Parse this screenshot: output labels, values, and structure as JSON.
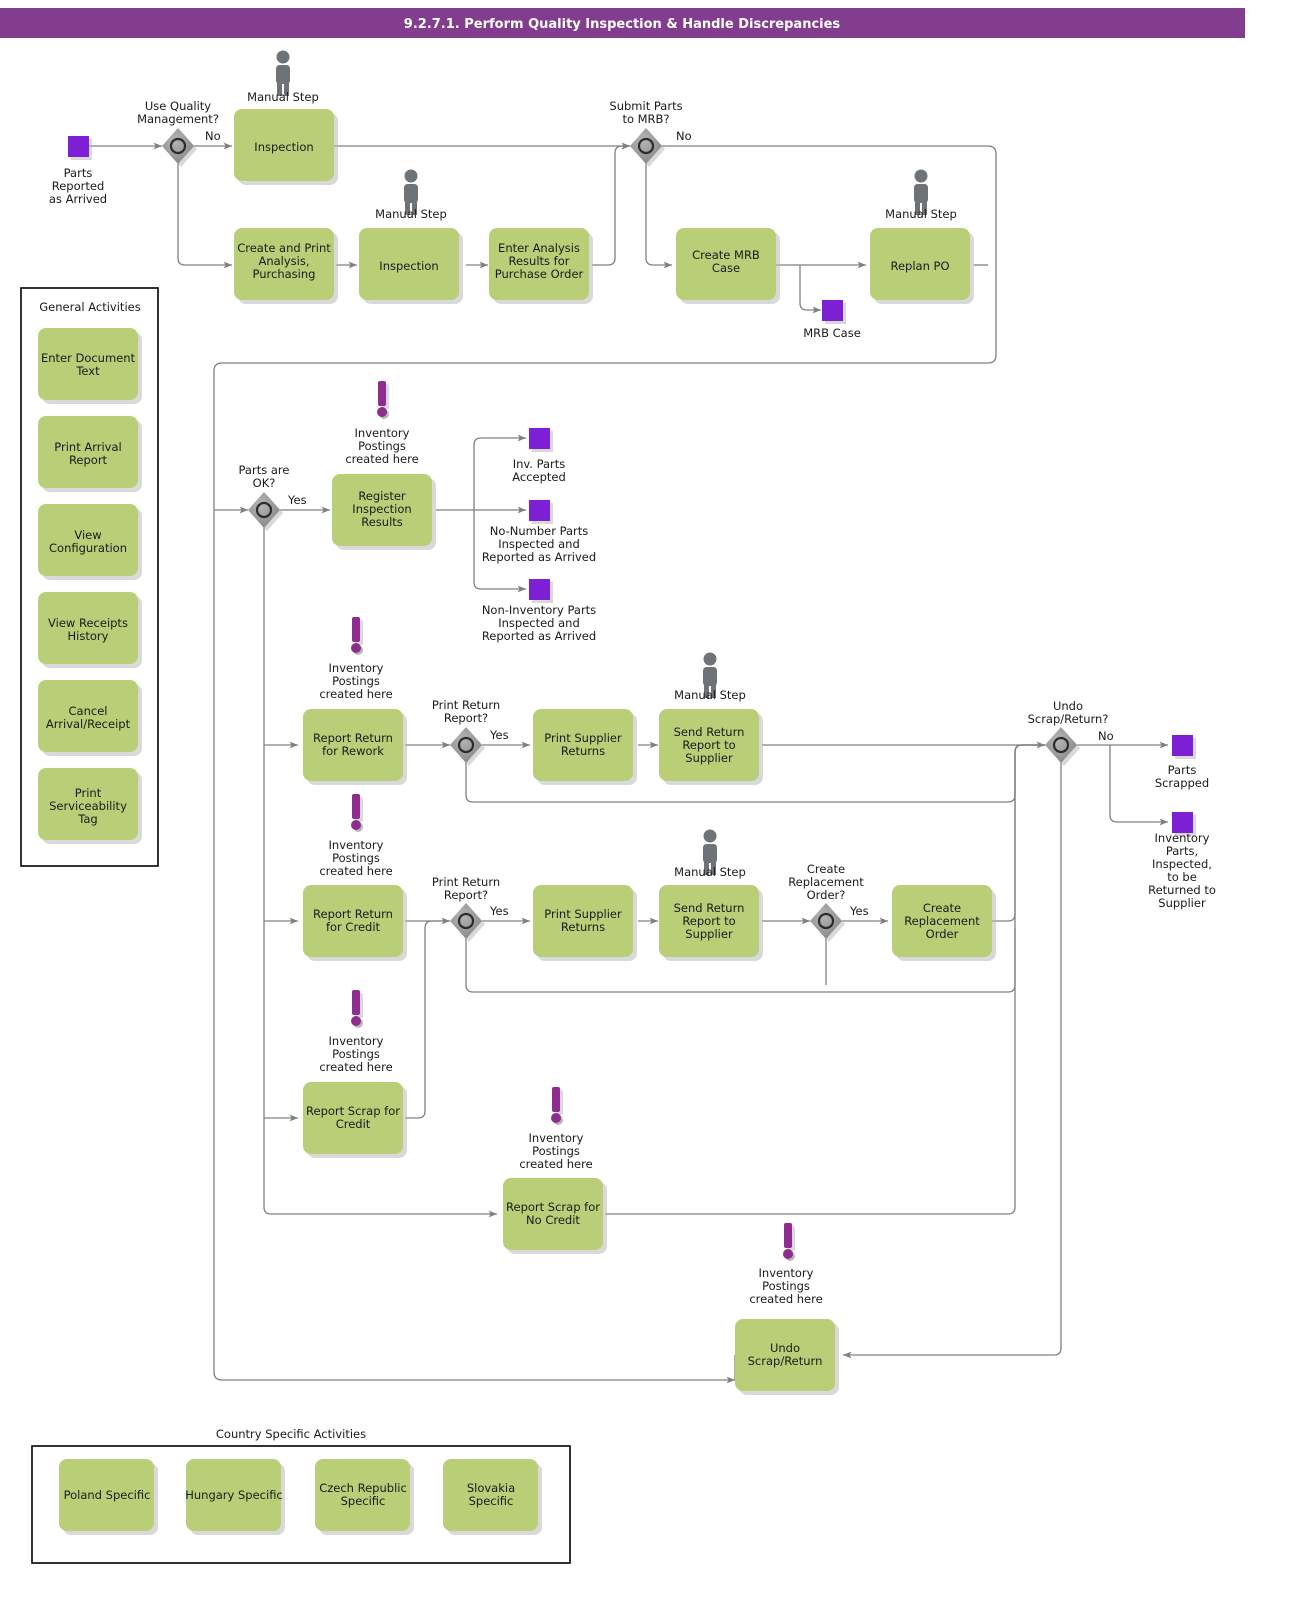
{
  "header": {
    "title": "9.2.7.1. Perform Quality Inspection & Handle Discrepancies"
  },
  "colors": {
    "header_bg": "#833d8e",
    "task_fill": "#b9ce77",
    "event_fill": "#7d1fd4",
    "gateway_fill": "#8c8c8c",
    "connector": "#808080",
    "actor": "#6e7378",
    "annotation": "#8e2d8e"
  },
  "start_events": [
    {
      "id": "parts-reported",
      "label": "Parts\nReported\nas Arrived"
    }
  ],
  "end_events": [
    {
      "id": "mrb-case",
      "label": "MRB Case"
    },
    {
      "id": "inv-parts-accepted",
      "label": "Inv. Parts\nAccepted"
    },
    {
      "id": "no-number-parts",
      "label": "No-Number Parts\nInspected and\nReported as Arrived"
    },
    {
      "id": "non-inventory-parts",
      "label": "Non-Inventory Parts\nInspected and\nReported as Arrived"
    },
    {
      "id": "parts-scrapped",
      "label": "Parts\nScrapped"
    },
    {
      "id": "inv-parts-returned",
      "label": "Inventory\nParts,\nInspected,\nto be\nReturned to\nSupplier"
    }
  ],
  "gateways": [
    {
      "id": "use-quality-management",
      "label": "Use Quality\nManagement?",
      "branch": "No"
    },
    {
      "id": "submit-parts-to-mrb",
      "label": "Submit Parts\nto MRB?",
      "branch": "No"
    },
    {
      "id": "parts-are-ok",
      "label": "Parts are\nOK?",
      "branch": "Yes"
    },
    {
      "id": "print-return-report-rework",
      "label": "Print Return\nReport?",
      "branch": "Yes"
    },
    {
      "id": "print-return-report-credit",
      "label": "Print Return\nReport?",
      "branch": "Yes"
    },
    {
      "id": "create-replacement-order-gw",
      "label": "Create\nReplacement\nOrder?",
      "branch": "Yes"
    },
    {
      "id": "undo-scrap-return-gw",
      "label": "Undo\nScrap/Return?",
      "branch": "No"
    }
  ],
  "tasks": [
    {
      "id": "inspection-1",
      "label": "Inspection",
      "manual": true,
      "manual_label": "Manual Step"
    },
    {
      "id": "create-print-analysis",
      "label": "Create and Print\nAnalysis,\nPurchasing",
      "manual": false
    },
    {
      "id": "inspection-2",
      "label": "Inspection",
      "manual": true,
      "manual_label": "Manual Step"
    },
    {
      "id": "enter-analysis-results",
      "label": "Enter Analysis\nResults for\nPurchase Order",
      "manual": false
    },
    {
      "id": "create-mrb-case",
      "label": "Create MRB\nCase",
      "manual": false
    },
    {
      "id": "replan-po",
      "label": "Replan PO",
      "manual": true,
      "manual_label": "Manual Step"
    },
    {
      "id": "register-inspection-results",
      "label": "Register\nInspection\nResults",
      "manual": false,
      "annotation": "Inventory\nPostings\ncreated here"
    },
    {
      "id": "report-return-for-rework",
      "label": "Report Return\nfor Rework",
      "manual": false,
      "annotation": "Inventory\nPostings\ncreated here"
    },
    {
      "id": "print-supplier-returns-1",
      "label": "Print Supplier\nReturns",
      "manual": false
    },
    {
      "id": "send-return-report-1",
      "label": "Send Return\nReport to\nSupplier",
      "manual": true,
      "manual_label": "Manual Step"
    },
    {
      "id": "report-return-for-credit",
      "label": "Report Return\nfor Credit",
      "manual": false,
      "annotation": "Inventory\nPostings\ncreated here"
    },
    {
      "id": "print-supplier-returns-2",
      "label": "Print Supplier\nReturns",
      "manual": false
    },
    {
      "id": "send-return-report-2",
      "label": "Send Return\nReport to\nSupplier",
      "manual": true,
      "manual_label": "Manual Step"
    },
    {
      "id": "create-replacement-order",
      "label": "Create\nReplacement\nOrder",
      "manual": false
    },
    {
      "id": "report-scrap-for-credit",
      "label": "Report Scrap for\nCredit",
      "manual": false,
      "annotation": "Inventory\nPostings\ncreated here"
    },
    {
      "id": "report-scrap-for-no-credit",
      "label": "Report Scrap for\nNo Credit",
      "manual": false,
      "annotation": "Inventory\nPostings\ncreated here"
    },
    {
      "id": "undo-scrap-return",
      "label": "Undo\nScrap/Return",
      "manual": false,
      "annotation": "Inventory\nPostings\ncreated here"
    }
  ],
  "general_activities": {
    "title": "General Activities",
    "items": [
      {
        "id": "enter-document-text",
        "label": "Enter Document\nText"
      },
      {
        "id": "print-arrival-report",
        "label": "Print Arrival\nReport"
      },
      {
        "id": "view-configuration",
        "label": "View\nConfiguration"
      },
      {
        "id": "view-receipts-history",
        "label": "View Receipts\nHistory"
      },
      {
        "id": "cancel-arrival-receipt",
        "label": "Cancel\nArrival/Receipt"
      },
      {
        "id": "print-serviceability-tag",
        "label": "Print\nServiceability\nTag"
      }
    ]
  },
  "country_specific_activities": {
    "title": "Country Specific Activities",
    "items": [
      {
        "id": "poland-specific",
        "label": "Poland Specific"
      },
      {
        "id": "hungary-specific",
        "label": "Hungary Specific"
      },
      {
        "id": "czech-republic-specific",
        "label": "Czech Republic\nSpecific"
      },
      {
        "id": "slovakia-specific",
        "label": "Slovakia\nSpecific"
      }
    ]
  },
  "annotation_text": "Inventory\nPostings\ncreated here",
  "manual_step_text": "Manual Step"
}
